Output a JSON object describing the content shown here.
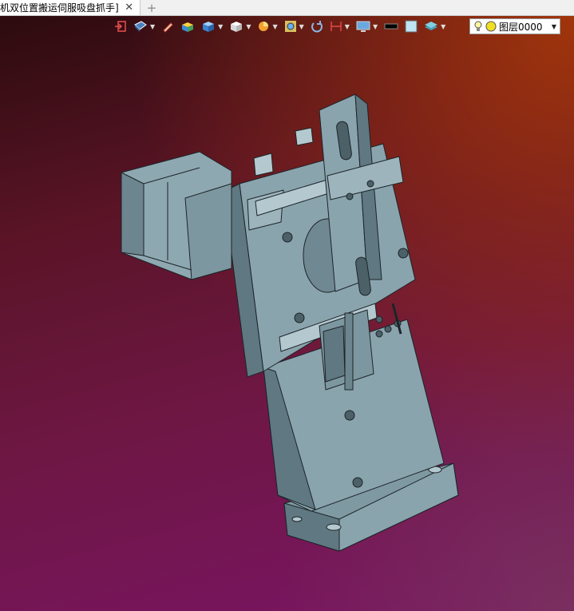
{
  "tabs": [
    {
      "label": "机双位置搬运伺服吸盘抓手]",
      "close": "✕"
    }
  ],
  "new_tab": "+",
  "toolbar": {
    "buttons": [
      {
        "name": "exit-icon"
      },
      {
        "name": "display-style-icon"
      },
      {
        "name": "pen-icon"
      },
      {
        "name": "box-color-icon"
      },
      {
        "name": "cube-icon"
      },
      {
        "name": "white-cube-icon"
      },
      {
        "name": "pie-section-icon"
      },
      {
        "name": "zoom-view-icon"
      },
      {
        "name": "rotate-icon"
      },
      {
        "name": "dimension-icon"
      },
      {
        "name": "monitor-icon"
      },
      {
        "name": "black-rect-icon"
      },
      {
        "name": "light-blue-square-icon"
      },
      {
        "name": "layer-stack-icon"
      }
    ],
    "layer": {
      "label": "图层0000"
    }
  },
  "colors": {
    "model_face": "#8aa4ae",
    "model_dark": "#5f7882",
    "model_light": "#b4c8cf",
    "edge": "#1c2428"
  }
}
